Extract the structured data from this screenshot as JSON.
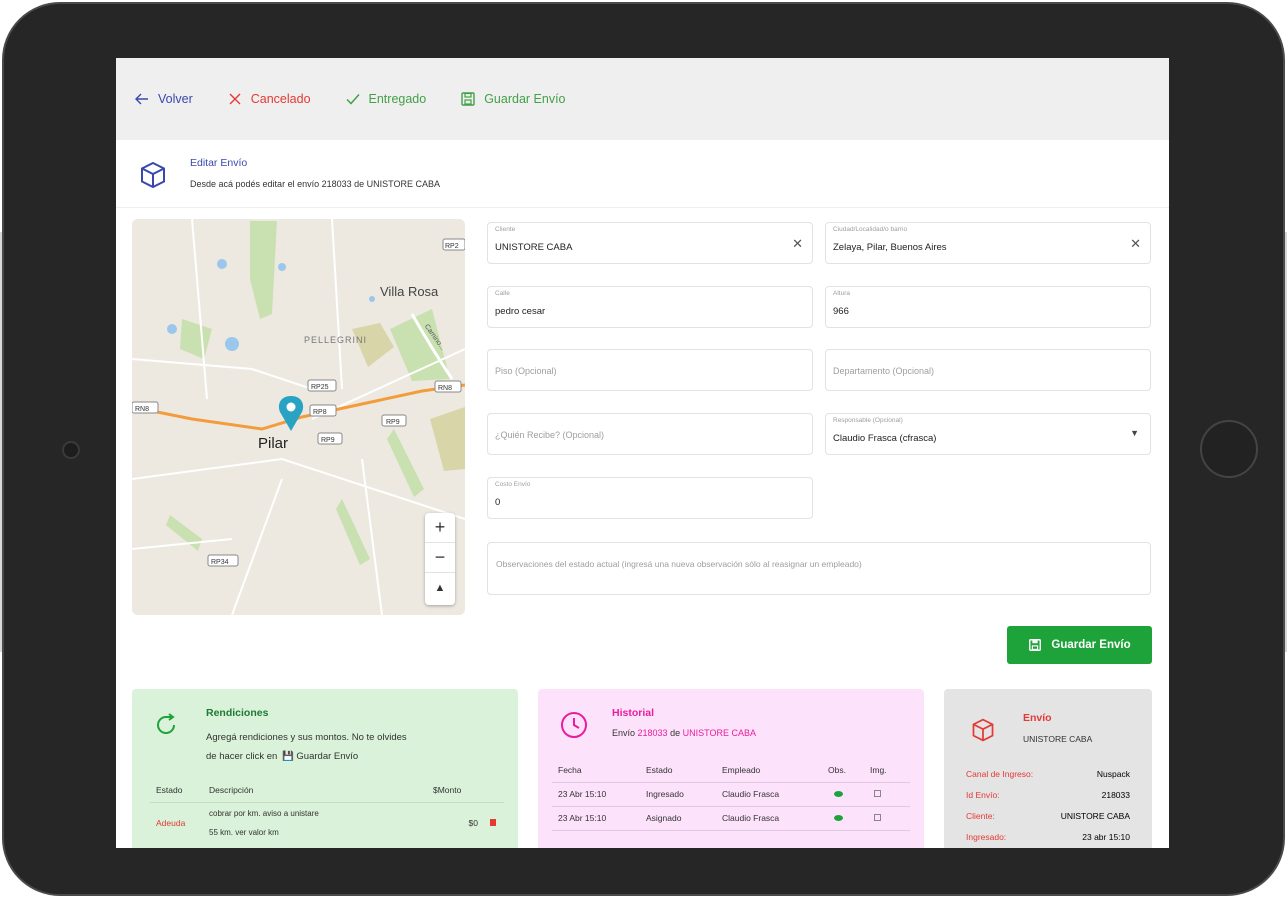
{
  "toolbar": {
    "back": "Volver",
    "cancel": "Cancelado",
    "delivered": "Entregado",
    "save": "Guardar Envío"
  },
  "header": {
    "title": "Editar Envío",
    "subtitle": "Desde acá podés editar el envío 218033 de UNISTORE CABA"
  },
  "map": {
    "labels": {
      "villa_rosa": "Villa Rosa",
      "pellegrini": "PELLEGRINI",
      "pilar": "Pilar",
      "road_curve": "Camino...",
      "rp25": "RP25",
      "rp8": "RP8",
      "rn8a": "RN8",
      "rn8b": "RN8",
      "rp9a": "RP9",
      "rp9b": "RP9",
      "rp34": "RP34",
      "rp2": "RP2"
    },
    "zoom_in": "+",
    "zoom_out": "−",
    "compass": "▲"
  },
  "form": {
    "client": {
      "label": "Cliente",
      "value": "UNISTORE CABA"
    },
    "city": {
      "label": "Ciudad/Localidad/o barrio",
      "value": "Zelaya, Pilar, Buenos Aires"
    },
    "street": {
      "label": "Calle",
      "value": "pedro cesar"
    },
    "height": {
      "label": "Altura",
      "value": "966"
    },
    "floor": {
      "placeholder": "Piso (Opcional)"
    },
    "apartment": {
      "placeholder": "Departamento (Opcional)"
    },
    "receiver": {
      "placeholder": "¿Quién Recibe? (Opcional)"
    },
    "responsible": {
      "label": "Responsable (Opcional)",
      "value": "Claudio Frasca (cfrasca)"
    },
    "cost": {
      "label": "Costo Envío",
      "value": "0"
    },
    "observations": {
      "placeholder": "Observaciones del estado actual (ingresá una nueva observación sólo al reasignar un empleado)"
    },
    "save_button": "Guardar Envío"
  },
  "rendiciones": {
    "title": "Rendiciones",
    "description_line1": "Agregá rendiciones y sus montos. No te olvides",
    "description_line2": "de hacer click en",
    "description_link": "Guardar Envío",
    "columns": [
      "Estado",
      "Descripción",
      "$Monto"
    ],
    "rows": [
      {
        "estado": "Adeuda",
        "descripcion_line1": "cobrar por km. aviso a unistare",
        "descripcion_line2": "55 km. ver valor km",
        "monto": "$0"
      }
    ]
  },
  "historial": {
    "title": "Historial",
    "subtitle_prefix": "Envío",
    "shipment_id": "218033",
    "subtitle_mid": "de",
    "client": "UNISTORE CABA",
    "columns": [
      "Fecha",
      "Estado",
      "Empleado",
      "Obs.",
      "Img."
    ],
    "rows": [
      {
        "fecha": "23 Abr 15:10",
        "estado": "Ingresado",
        "empleado": "Claudio Frasca"
      },
      {
        "fecha": "23 Abr 15:10",
        "estado": "Asignado",
        "empleado": "Claudio Frasca"
      }
    ]
  },
  "envio": {
    "title": "Envío",
    "client": "UNISTORE CABA",
    "rows": [
      {
        "key": "Canal de Ingreso:",
        "value": "Nuspack"
      },
      {
        "key": "Id Envío:",
        "value": "218033"
      },
      {
        "key": "Cliente:",
        "value": "UNISTORE CABA"
      },
      {
        "key": "Ingresado:",
        "value": "23 abr 15:10"
      }
    ]
  },
  "colors": {
    "primary_blue": "#3949ab",
    "cancel_red": "#e53935",
    "success_green": "#1ea33a",
    "pink_accent": "#e91e9c"
  }
}
